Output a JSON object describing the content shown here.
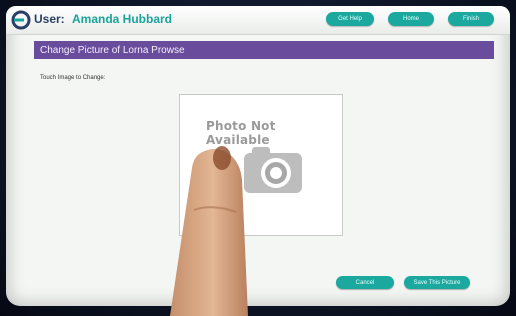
{
  "header": {
    "user_label": "User:",
    "user_name": "Amanda Hubbard",
    "buttons": [
      "Get Help",
      "Home",
      "Finish"
    ]
  },
  "title": "Change Picture of Lorna Prowse",
  "instruction": "Touch Image to Change:",
  "photo": {
    "placeholder_text": "Photo Not Available",
    "icon": "camera-icon"
  },
  "footer": {
    "cancel_label": "Cancel",
    "save_label": "Save This Picture"
  },
  "colors": {
    "accent_teal": "#1aa89f",
    "title_purple": "#6a4c9c",
    "user_label": "#2b3f66"
  }
}
